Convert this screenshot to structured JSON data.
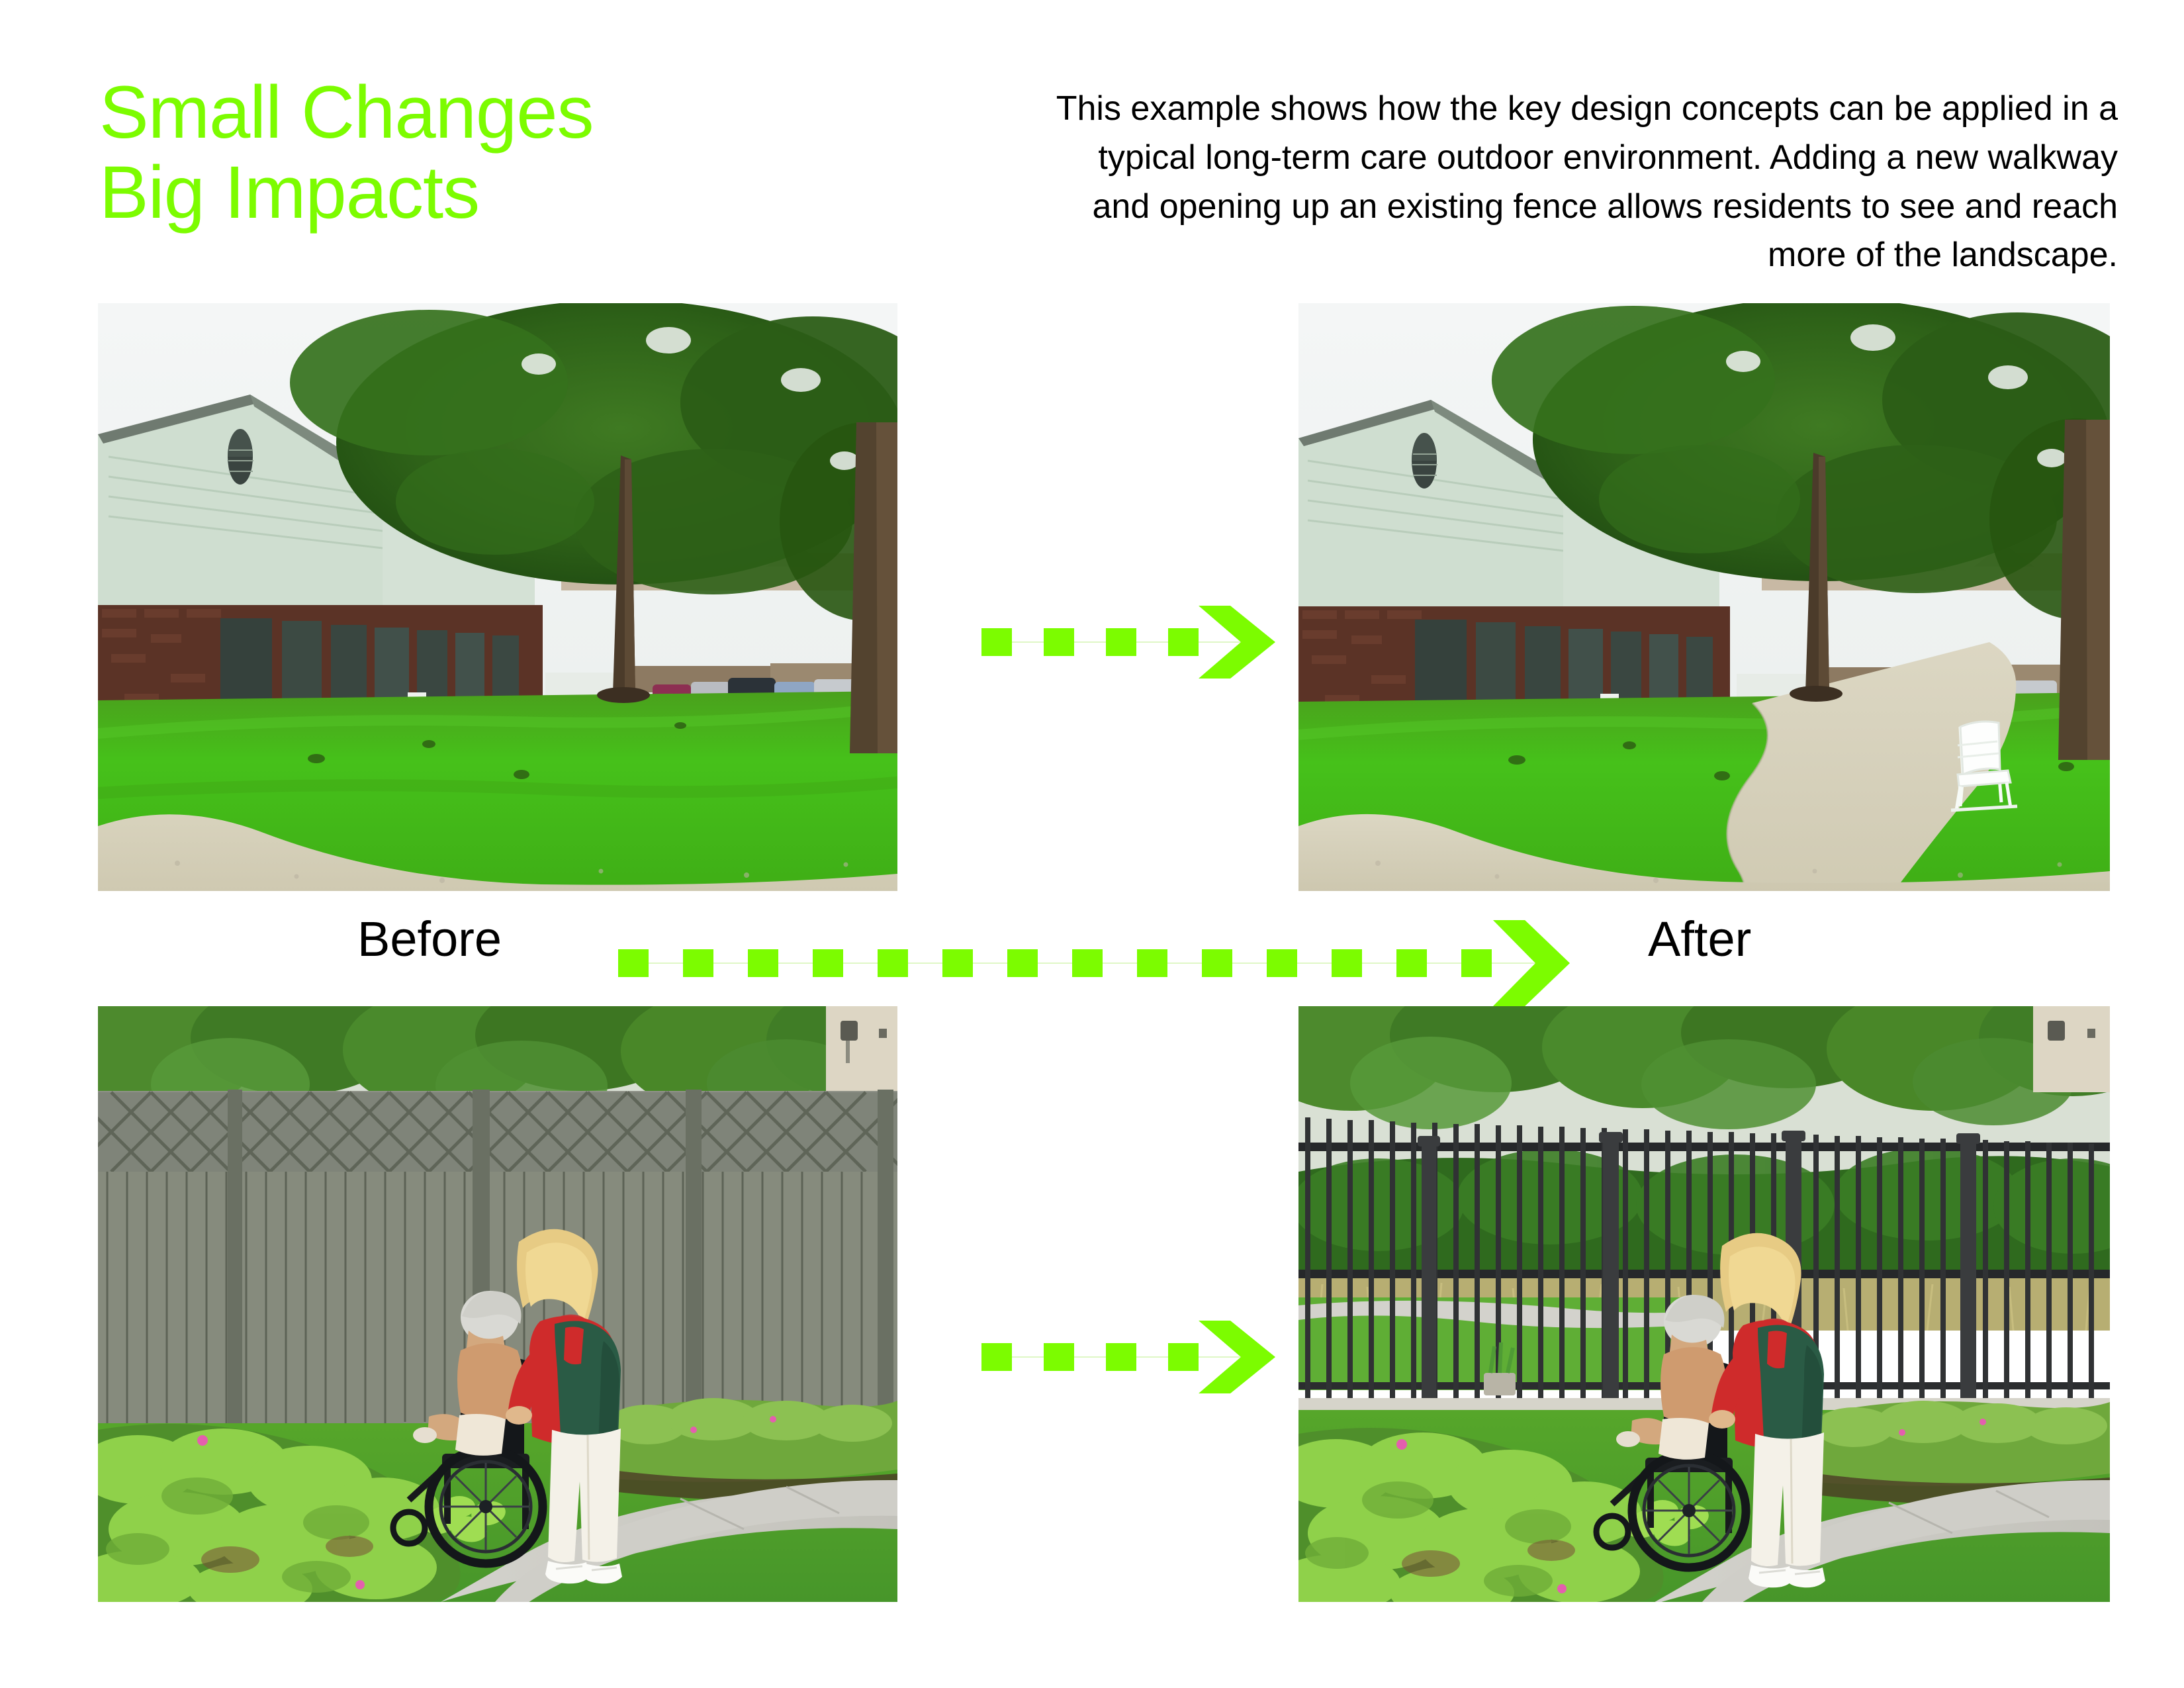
{
  "page": {
    "background_color": "#ffffff",
    "accent_green": "#7CFC00",
    "text_color": "#000000"
  },
  "header": {
    "title": "Small Changes\nBig Impacts",
    "title_line1": "Small Changes",
    "title_line2": "Big Impacts",
    "intro_paragraph": "This example shows how the key design concepts can be applied in a typical long-term care outdoor environment. Adding a new walkway and opening up an existing fence allows residents to see and reach more of the landscape."
  },
  "labels": {
    "before": "Before",
    "after": "After"
  },
  "arrows": [
    {
      "name": "top-row-arrow",
      "dash_count": 4,
      "direction": "right",
      "color": "#7CFC00"
    },
    {
      "name": "middle-arrow",
      "dash_count": 14,
      "direction": "right",
      "color": "#7CFC00"
    },
    {
      "name": "bottom-row-arrow",
      "dash_count": 4,
      "direction": "right",
      "color": "#7CFC00"
    }
  ],
  "photos": [
    {
      "id": "photo-top-left",
      "stage": "Before",
      "row": "top",
      "caption": "Lawn beside long-term care building with mature oak tree and no walkway",
      "elements": [
        "brick building",
        "green gable roof",
        "arched gable vent",
        "window band",
        "mature oak tree",
        "open lawn",
        "parked cars",
        "wood privacy fence",
        "concrete pad at lower left"
      ]
    },
    {
      "id": "photo-top-right",
      "stage": "After",
      "row": "top",
      "caption": "Same lawn with a new curving concrete walkway and a white garden bench under the tree",
      "elements": [
        "brick building",
        "green gable roof",
        "arched gable vent",
        "window band",
        "mature oak tree",
        "new curving walkway",
        "white garden bench",
        "parked cars",
        "wood privacy fence"
      ]
    },
    {
      "id": "photo-bottom-left",
      "stage": "Before",
      "row": "bottom",
      "caption": "Caregiver pushing a resident in a wheelchair facing a solid wood lattice-top privacy fence",
      "elements": [
        "solid wood privacy fence",
        "lattice fence top",
        "caregiver in green vest and red shirt",
        "resident in wheelchair",
        "azalea shrub bed",
        "pink blossoms",
        "concrete path",
        "lawn"
      ]
    },
    {
      "id": "photo-bottom-right",
      "stage": "After",
      "row": "bottom",
      "caption": "Same pair at an open black metal picket fence with a view through to the landscape beyond",
      "elements": [
        "open black metal picket fence",
        "view to meadow and path beyond",
        "caregiver in green vest and red shirt",
        "resident in wheelchair",
        "azalea shrub bed",
        "pink blossoms",
        "concrete path",
        "lawn"
      ]
    }
  ]
}
